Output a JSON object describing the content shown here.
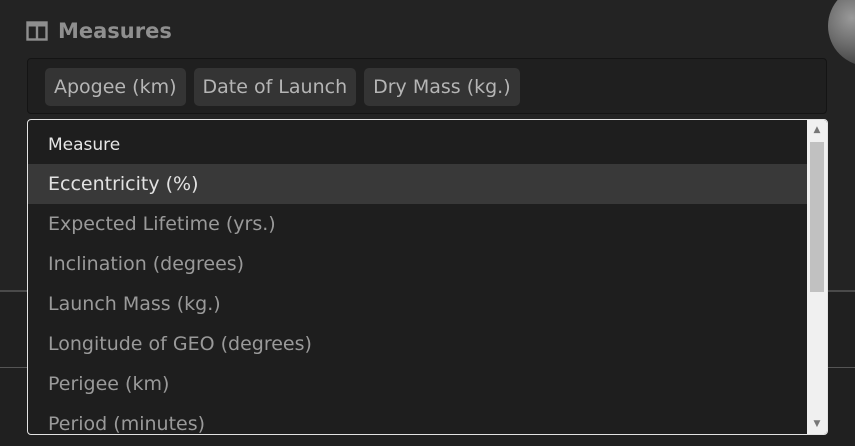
{
  "header": {
    "title": "Measures",
    "icon": "table-columns-icon"
  },
  "selected_measures": [
    {
      "label": "Apogee (km)"
    },
    {
      "label": "Date of Launch"
    },
    {
      "label": "Dry Mass (kg.)"
    }
  ],
  "dropdown": {
    "group_label": "Measure",
    "options": [
      {
        "label": "Eccentricity (%)",
        "highlighted": true
      },
      {
        "label": "Expected Lifetime (yrs.)",
        "highlighted": false
      },
      {
        "label": "Inclination (degrees)",
        "highlighted": false
      },
      {
        "label": "Launch Mass (kg.)",
        "highlighted": false
      },
      {
        "label": "Longitude of GEO (degrees)",
        "highlighted": false
      },
      {
        "label": "Perigee (km)",
        "highlighted": false
      },
      {
        "label": "Period (minutes)",
        "highlighted": false
      }
    ],
    "scroll_up_glyph": "▲",
    "scroll_down_glyph": "▼"
  },
  "colors": {
    "background": "#222222",
    "chip_bg": "#343434",
    "highlight_bg": "#393939",
    "dropdown_border": "#e3e3e3"
  }
}
